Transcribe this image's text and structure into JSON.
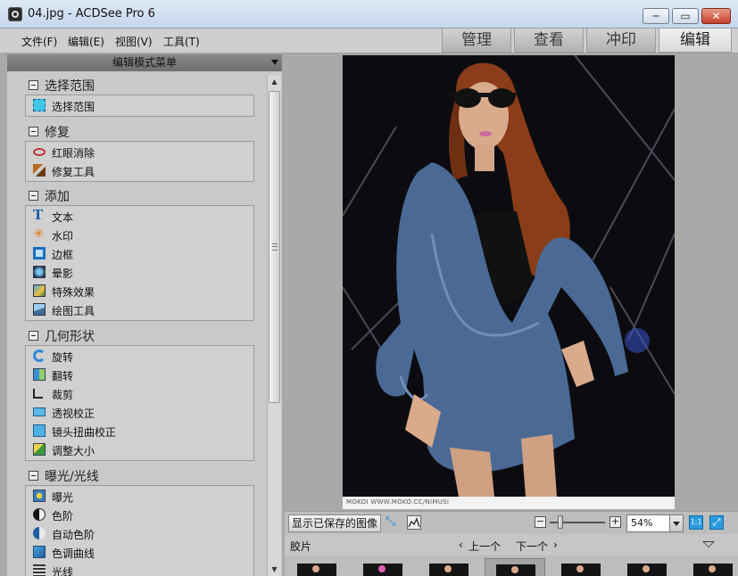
{
  "window": {
    "title": "04.jpg - ACDSee Pro 6",
    "controls": {
      "minimize": "─",
      "maximize": "▭",
      "close": "✕"
    }
  },
  "menu": [
    {
      "label": "文件(F)"
    },
    {
      "label": "编辑(E)"
    },
    {
      "label": "视图(V)"
    },
    {
      "label": "工具(T)"
    }
  ],
  "modes": [
    {
      "label": "管理"
    },
    {
      "label": "查看"
    },
    {
      "label": "冲印"
    },
    {
      "label": "编辑",
      "active": true
    }
  ],
  "left_panel": {
    "header": "编辑模式菜单",
    "sections": [
      {
        "title": "选择范围",
        "items": [
          {
            "label": "选择范围",
            "icon": "selection-icon"
          }
        ]
      },
      {
        "title": "修复",
        "items": [
          {
            "label": "红眼消除",
            "icon": "red-eye-icon"
          },
          {
            "label": "修复工具",
            "icon": "repair-tool-icon"
          }
        ]
      },
      {
        "title": "添加",
        "items": [
          {
            "label": "文本",
            "icon": "text-icon"
          },
          {
            "label": "水印",
            "icon": "watermark-icon"
          },
          {
            "label": "边框",
            "icon": "border-icon"
          },
          {
            "label": "晕影",
            "icon": "vignette-icon"
          },
          {
            "label": "特殊效果",
            "icon": "special-effects-icon"
          },
          {
            "label": "绘图工具",
            "icon": "drawing-tools-icon"
          }
        ]
      },
      {
        "title": "几何形状",
        "items": [
          {
            "label": "旋转",
            "icon": "rotate-icon"
          },
          {
            "label": "翻转",
            "icon": "flip-icon"
          },
          {
            "label": "裁剪",
            "icon": "crop-icon"
          },
          {
            "label": "透视校正",
            "icon": "perspective-icon"
          },
          {
            "label": "镜头扭曲校正",
            "icon": "lens-distortion-icon"
          },
          {
            "label": "调整大小",
            "icon": "resize-icon"
          }
        ]
      },
      {
        "title": "曝光/光线",
        "items": [
          {
            "label": "曝光",
            "icon": "exposure-icon"
          },
          {
            "label": "色阶",
            "icon": "levels-icon"
          },
          {
            "label": "自动色阶",
            "icon": "auto-levels-icon"
          },
          {
            "label": "色调曲线",
            "icon": "tone-curve-icon"
          },
          {
            "label": "光线",
            "icon": "light-icon"
          }
        ]
      }
    ]
  },
  "preview": {
    "watermark_text": "MOKOI WWW.MOKO.CC/NIMUSI",
    "colors": {
      "denim": "#4a6a95",
      "hair": "#8a3d18",
      "background": "#0c0c10"
    }
  },
  "view_toolbar": {
    "show_saved_label": "显示已保存的图像",
    "zoom_value": "54%",
    "zoom_minus": "−",
    "zoom_plus": "+",
    "zoom_slider_level": 0.2,
    "actual_size_label": "1:1"
  },
  "filmstrip": {
    "label": "胶片",
    "prev_label": "上一个",
    "next_label": "下一个",
    "selected_index": 3,
    "thumbnail_count": 7
  }
}
